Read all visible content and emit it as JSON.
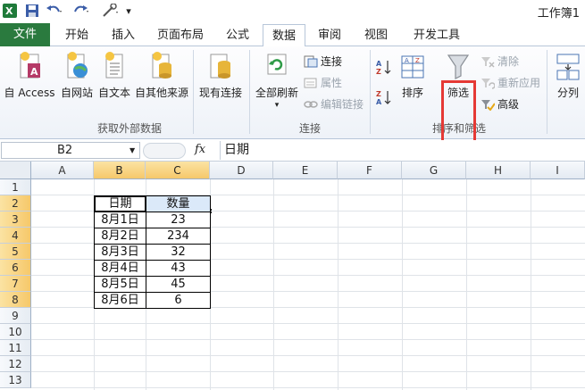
{
  "window": {
    "title": "工作簿1"
  },
  "tabs": [
    {
      "label": "文件"
    },
    {
      "label": "开始"
    },
    {
      "label": "插入"
    },
    {
      "label": "页面布局"
    },
    {
      "label": "公式"
    },
    {
      "label": "数据"
    },
    {
      "label": "审阅"
    },
    {
      "label": "视图"
    },
    {
      "label": "开发工具"
    }
  ],
  "ribbon": {
    "get_external": {
      "group_label": "获取外部数据",
      "access": "自 Access",
      "web": "自网站",
      "text": "自文本",
      "other": "自其他来源",
      "existing": "现有连接"
    },
    "connections": {
      "group_label": "连接",
      "refresh_all": "全部刷新",
      "connections": "连接",
      "properties": "属性",
      "edit_links": "编辑链接"
    },
    "sort_filter": {
      "group_label": "排序和筛选",
      "sort": "排序",
      "filter": "筛选",
      "clear": "清除",
      "reapply": "重新应用",
      "advanced": "高级"
    },
    "data_tools": {
      "text_to_columns": "分列"
    }
  },
  "formula_bar": {
    "name_box": "B2",
    "fx": "fx",
    "value": "日期"
  },
  "grid": {
    "columns": [
      "A",
      "B",
      "C",
      "D",
      "E",
      "F",
      "G",
      "H",
      "I"
    ],
    "rows": [
      "1",
      "2",
      "3",
      "4",
      "5",
      "6",
      "7",
      "8",
      "9",
      "10",
      "11",
      "12",
      "13"
    ],
    "table": {
      "headers": [
        "日期",
        "数量"
      ],
      "rows": [
        [
          "8月1日",
          "23"
        ],
        [
          "8月2日",
          "234"
        ],
        [
          "8月3日",
          "32"
        ],
        [
          "8月4日",
          "43"
        ],
        [
          "8月5日",
          "45"
        ],
        [
          "8月6日",
          "6"
        ]
      ]
    }
  },
  "colors": {
    "file_tab": "#2a7a3e",
    "highlight_box": "#e53935",
    "selected_header": "#f6c86a"
  }
}
